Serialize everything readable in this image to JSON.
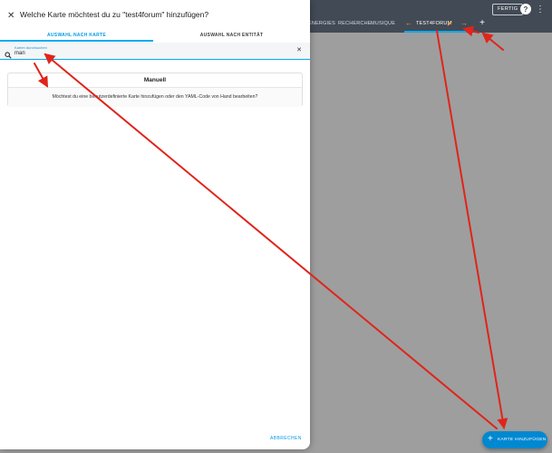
{
  "topbar": {
    "tabs": [
      "ENERGIES",
      "RECHERCHE",
      "MUSIQUE"
    ],
    "active_tab": "TEST4FORUM",
    "done_label": "FERTIG",
    "help_icon": "help-circle-icon",
    "menu_icon": "more-vertical-icon"
  },
  "dialog": {
    "title": "Welche Karte möchtest du zu \"test4forum\" hinzufügen?",
    "tabs": [
      "AUSWAHL NACH KARTE",
      "AUSWAHL NACH ENTITÄT"
    ],
    "search": {
      "label": "Karten durchsuchen",
      "value": "man"
    },
    "card": {
      "title": "Manuell",
      "description": "Möchtest du eine benutzerdefinierte Karte hinzufügen oder den YAML-Code von Hand bearbeiten?"
    },
    "cancel_label": "ABBRECHEN"
  },
  "fab": {
    "label": "KARTE HINZUFÜGEN"
  },
  "colors": {
    "accent": "#03a9f4",
    "topbar": "#424a55",
    "annotation_arrow": "#e0241b"
  }
}
